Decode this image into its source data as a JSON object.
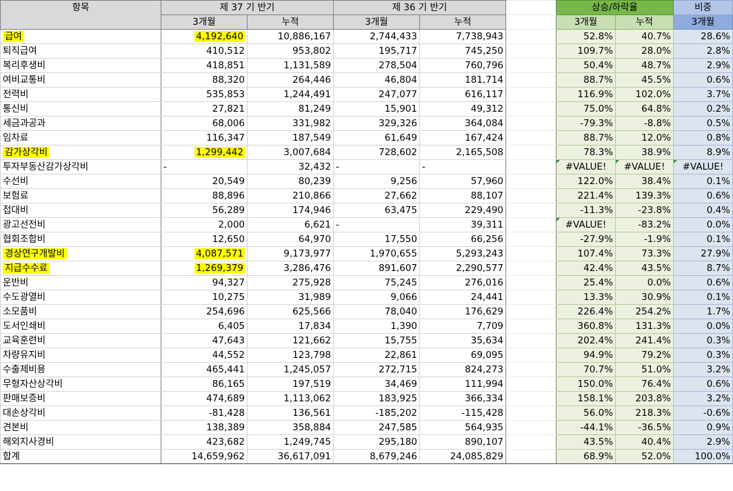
{
  "header": {
    "item_label": "항목",
    "period_37": "제 37 기 반기",
    "period_36": "제 36 기 반기",
    "sub_3m": "3개월",
    "sub_cum": "누적",
    "change_label": "상승/하락율",
    "share_label": "비중"
  },
  "rows": [
    {
      "name": "급여",
      "p37_3m": "4,192,640",
      "p37_cum": "10,886,167",
      "p36_3m": "2,744,433",
      "p36_cum": "7,738,943",
      "ch_3m": "52.8%",
      "ch_cum": "40.7%",
      "share": "28.6%"
    },
    {
      "name": "퇴직급여",
      "p37_3m": "410,512",
      "p37_cum": "953,802",
      "p36_3m": "195,717",
      "p36_cum": "745,250",
      "ch_3m": "109.7%",
      "ch_cum": "28.0%",
      "share": "2.8%"
    },
    {
      "name": "복리후생비",
      "p37_3m": "418,851",
      "p37_cum": "1,131,589",
      "p36_3m": "278,504",
      "p36_cum": "760,796",
      "ch_3m": "50.4%",
      "ch_cum": "48.7%",
      "share": "2.9%"
    },
    {
      "name": "여비교통비",
      "p37_3m": "88,320",
      "p37_cum": "264,446",
      "p36_3m": "46,804",
      "p36_cum": "181,714",
      "ch_3m": "88.7%",
      "ch_cum": "45.5%",
      "share": "0.6%"
    },
    {
      "name": "전력비",
      "p37_3m": "535,853",
      "p37_cum": "1,244,491",
      "p36_3m": "247,077",
      "p36_cum": "616,117",
      "ch_3m": "116.9%",
      "ch_cum": "102.0%",
      "share": "3.7%"
    },
    {
      "name": "통신비",
      "p37_3m": "27,821",
      "p37_cum": "81,249",
      "p36_3m": "15,901",
      "p36_cum": "49,312",
      "ch_3m": "75.0%",
      "ch_cum": "64.8%",
      "share": "0.2%"
    },
    {
      "name": "세금과공과",
      "p37_3m": "68,006",
      "p37_cum": "331,982",
      "p36_3m": "329,326",
      "p36_cum": "364,084",
      "ch_3m": "-79.3%",
      "ch_cum": "-8.8%",
      "share": "0.5%"
    },
    {
      "name": "임차료",
      "p37_3m": "116,347",
      "p37_cum": "187,549",
      "p36_3m": "61,649",
      "p36_cum": "167,424",
      "ch_3m": "88.7%",
      "ch_cum": "12.0%",
      "share": "0.8%"
    },
    {
      "name": "감가상각비",
      "p37_3m": "1,299,442",
      "p37_cum": "3,007,684",
      "p36_3m": "728,602",
      "p36_cum": "2,165,508",
      "ch_3m": "78.3%",
      "ch_cum": "38.9%",
      "share": "8.9%"
    },
    {
      "name": "투자부동산감가상각비",
      "p37_3m": "-",
      "p37_cum": "32,432",
      "p36_3m": "-",
      "p36_cum": "-",
      "ch_3m": "#VALUE!",
      "ch_cum": "#VALUE!",
      "share": "#VALUE!"
    },
    {
      "name": "수선비",
      "p37_3m": "20,549",
      "p37_cum": "80,239",
      "p36_3m": "9,256",
      "p36_cum": "57,960",
      "ch_3m": "122.0%",
      "ch_cum": "38.4%",
      "share": "0.1%"
    },
    {
      "name": "보험료",
      "p37_3m": "88,896",
      "p37_cum": "210,866",
      "p36_3m": "27,662",
      "p36_cum": "88,107",
      "ch_3m": "221.4%",
      "ch_cum": "139.3%",
      "share": "0.6%"
    },
    {
      "name": "접대비",
      "p37_3m": "56,289",
      "p37_cum": "174,946",
      "p36_3m": "63,475",
      "p36_cum": "229,490",
      "ch_3m": "-11.3%",
      "ch_cum": "-23.8%",
      "share": "0.4%"
    },
    {
      "name": "광고선전비",
      "p37_3m": "2,000",
      "p37_cum": "6,621",
      "p36_3m": "-",
      "p36_cum": "39,311",
      "ch_3m": "#VALUE!",
      "ch_cum": "-83.2%",
      "share": "0.0%"
    },
    {
      "name": "협회조합비",
      "p37_3m": "12,650",
      "p37_cum": "64,970",
      "p36_3m": "17,550",
      "p36_cum": "66,256",
      "ch_3m": "-27.9%",
      "ch_cum": "-1.9%",
      "share": "0.1%"
    },
    {
      "name": "경상연구개발비",
      "p37_3m": "4,087,571",
      "p37_cum": "9,173,977",
      "p36_3m": "1,970,655",
      "p36_cum": "5,293,243",
      "ch_3m": "107.4%",
      "ch_cum": "73.3%",
      "share": "27.9%"
    },
    {
      "name": "지급수수료",
      "p37_3m": "1,269,379",
      "p37_cum": "3,286,476",
      "p36_3m": "891,607",
      "p36_cum": "2,290,577",
      "ch_3m": "42.4%",
      "ch_cum": "43.5%",
      "share": "8.7%"
    },
    {
      "name": "운반비",
      "p37_3m": "94,327",
      "p37_cum": "275,928",
      "p36_3m": "75,245",
      "p36_cum": "276,016",
      "ch_3m": "25.4%",
      "ch_cum": "0.0%",
      "share": "0.6%"
    },
    {
      "name": "수도광열비",
      "p37_3m": "10,275",
      "p37_cum": "31,989",
      "p36_3m": "9,066",
      "p36_cum": "24,441",
      "ch_3m": "13.3%",
      "ch_cum": "30.9%",
      "share": "0.1%"
    },
    {
      "name": "소모품비",
      "p37_3m": "254,696",
      "p37_cum": "625,566",
      "p36_3m": "78,040",
      "p36_cum": "176,629",
      "ch_3m": "226.4%",
      "ch_cum": "254.2%",
      "share": "1.7%"
    },
    {
      "name": "도서인쇄비",
      "p37_3m": "6,405",
      "p37_cum": "17,834",
      "p36_3m": "1,390",
      "p36_cum": "7,709",
      "ch_3m": "360.8%",
      "ch_cum": "131.3%",
      "share": "0.0%"
    },
    {
      "name": "교육훈련비",
      "p37_3m": "47,643",
      "p37_cum": "121,662",
      "p36_3m": "15,755",
      "p36_cum": "35,634",
      "ch_3m": "202.4%",
      "ch_cum": "241.4%",
      "share": "0.3%"
    },
    {
      "name": "차량유지비",
      "p37_3m": "44,552",
      "p37_cum": "123,798",
      "p36_3m": "22,861",
      "p36_cum": "69,095",
      "ch_3m": "94.9%",
      "ch_cum": "79.2%",
      "share": "0.3%"
    },
    {
      "name": "수출제비용",
      "p37_3m": "465,441",
      "p37_cum": "1,245,057",
      "p36_3m": "272,715",
      "p36_cum": "824,273",
      "ch_3m": "70.7%",
      "ch_cum": "51.0%",
      "share": "3.2%"
    },
    {
      "name": "무형자산상각비",
      "p37_3m": "86,165",
      "p37_cum": "197,519",
      "p36_3m": "34,469",
      "p36_cum": "111,994",
      "ch_3m": "150.0%",
      "ch_cum": "76.4%",
      "share": "0.6%"
    },
    {
      "name": "판매보증비",
      "p37_3m": "474,689",
      "p37_cum": "1,113,062",
      "p36_3m": "183,925",
      "p36_cum": "366,334",
      "ch_3m": "158.1%",
      "ch_cum": "203.8%",
      "share": "3.2%"
    },
    {
      "name": "대손상각비",
      "p37_3m": "-81,428",
      "p37_cum": "136,561",
      "p36_3m": "-185,202",
      "p36_cum": "-115,428",
      "ch_3m": "56.0%",
      "ch_cum": "218.3%",
      "share": "-0.6%"
    },
    {
      "name": "견본비",
      "p37_3m": "138,389",
      "p37_cum": "358,884",
      "p36_3m": "247,585",
      "p36_cum": "564,935",
      "ch_3m": "-44.1%",
      "ch_cum": "-36.5%",
      "share": "0.9%"
    },
    {
      "name": "해외지사경비",
      "p37_3m": "423,682",
      "p37_cum": "1,249,745",
      "p36_3m": "295,180",
      "p36_cum": "890,107",
      "ch_3m": "43.5%",
      "ch_cum": "40.4%",
      "share": "2.9%"
    },
    {
      "name": "합계",
      "p37_3m": "14,659,962",
      "p37_cum": "36,617,091",
      "p36_3m": "8,679,246",
      "p36_cum": "24,085,829",
      "ch_3m": "68.9%",
      "ch_cum": "52.0%",
      "share": "100.0%"
    }
  ],
  "highlighted_rows": [
    "급여",
    "감가상각비",
    "경상연구개발비",
    "지급수수료"
  ],
  "colors": {
    "highlight": "#ffff00",
    "change_header": "#77b84a",
    "change_sub": "#c6e0b4",
    "share_header": "#b4c6e7",
    "share_sub": "#8faadc",
    "change_cells": "#ebf1de",
    "share_cells": "#dce4f0"
  }
}
